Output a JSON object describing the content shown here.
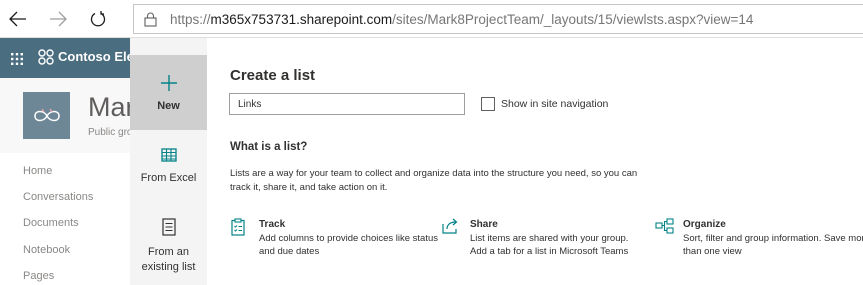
{
  "browser": {
    "url_scheme": "https://",
    "url_host": "m365x753731.sharepoint.com",
    "url_path": "/sites/Mark8ProjectTeam/_layouts/15/viewlsts.aspx?view=14"
  },
  "suite": {
    "brand": "Contoso Ele"
  },
  "site": {
    "name": "Mark",
    "subtitle": "Public gro"
  },
  "left_nav": [
    "Home",
    "Conversations",
    "Documents",
    "Notebook",
    "Pages"
  ],
  "rail": {
    "new_label": "New",
    "excel_label": "From Excel",
    "existing_label_1": "From an",
    "existing_label_2": "existing list"
  },
  "panel": {
    "title": "Create a list",
    "name_value": "Links",
    "show_nav_label": "Show in site navigation",
    "show_nav_checked": false,
    "what_heading": "What is a list?",
    "description": "Lists are a way for your team to collect and organize data into the structure you need, so you can track it, share it, and take action on it."
  },
  "features": [
    {
      "title": "Track",
      "desc": "Add columns to provide choices like status and due dates",
      "icon": "clipboard-icon"
    },
    {
      "title": "Share",
      "desc": "List items are shared with your group. Add a tab for a list in Microsoft Teams",
      "icon": "share-icon"
    },
    {
      "title": "Organize",
      "desc": "Sort, filter and group information. Save more than one view",
      "icon": "organize-icon"
    }
  ],
  "colors": {
    "suite_bar": "#4b6d80",
    "accent": "#038387",
    "rail_bg": "#f4f4f4",
    "rail_selected": "#cfcfcf"
  }
}
